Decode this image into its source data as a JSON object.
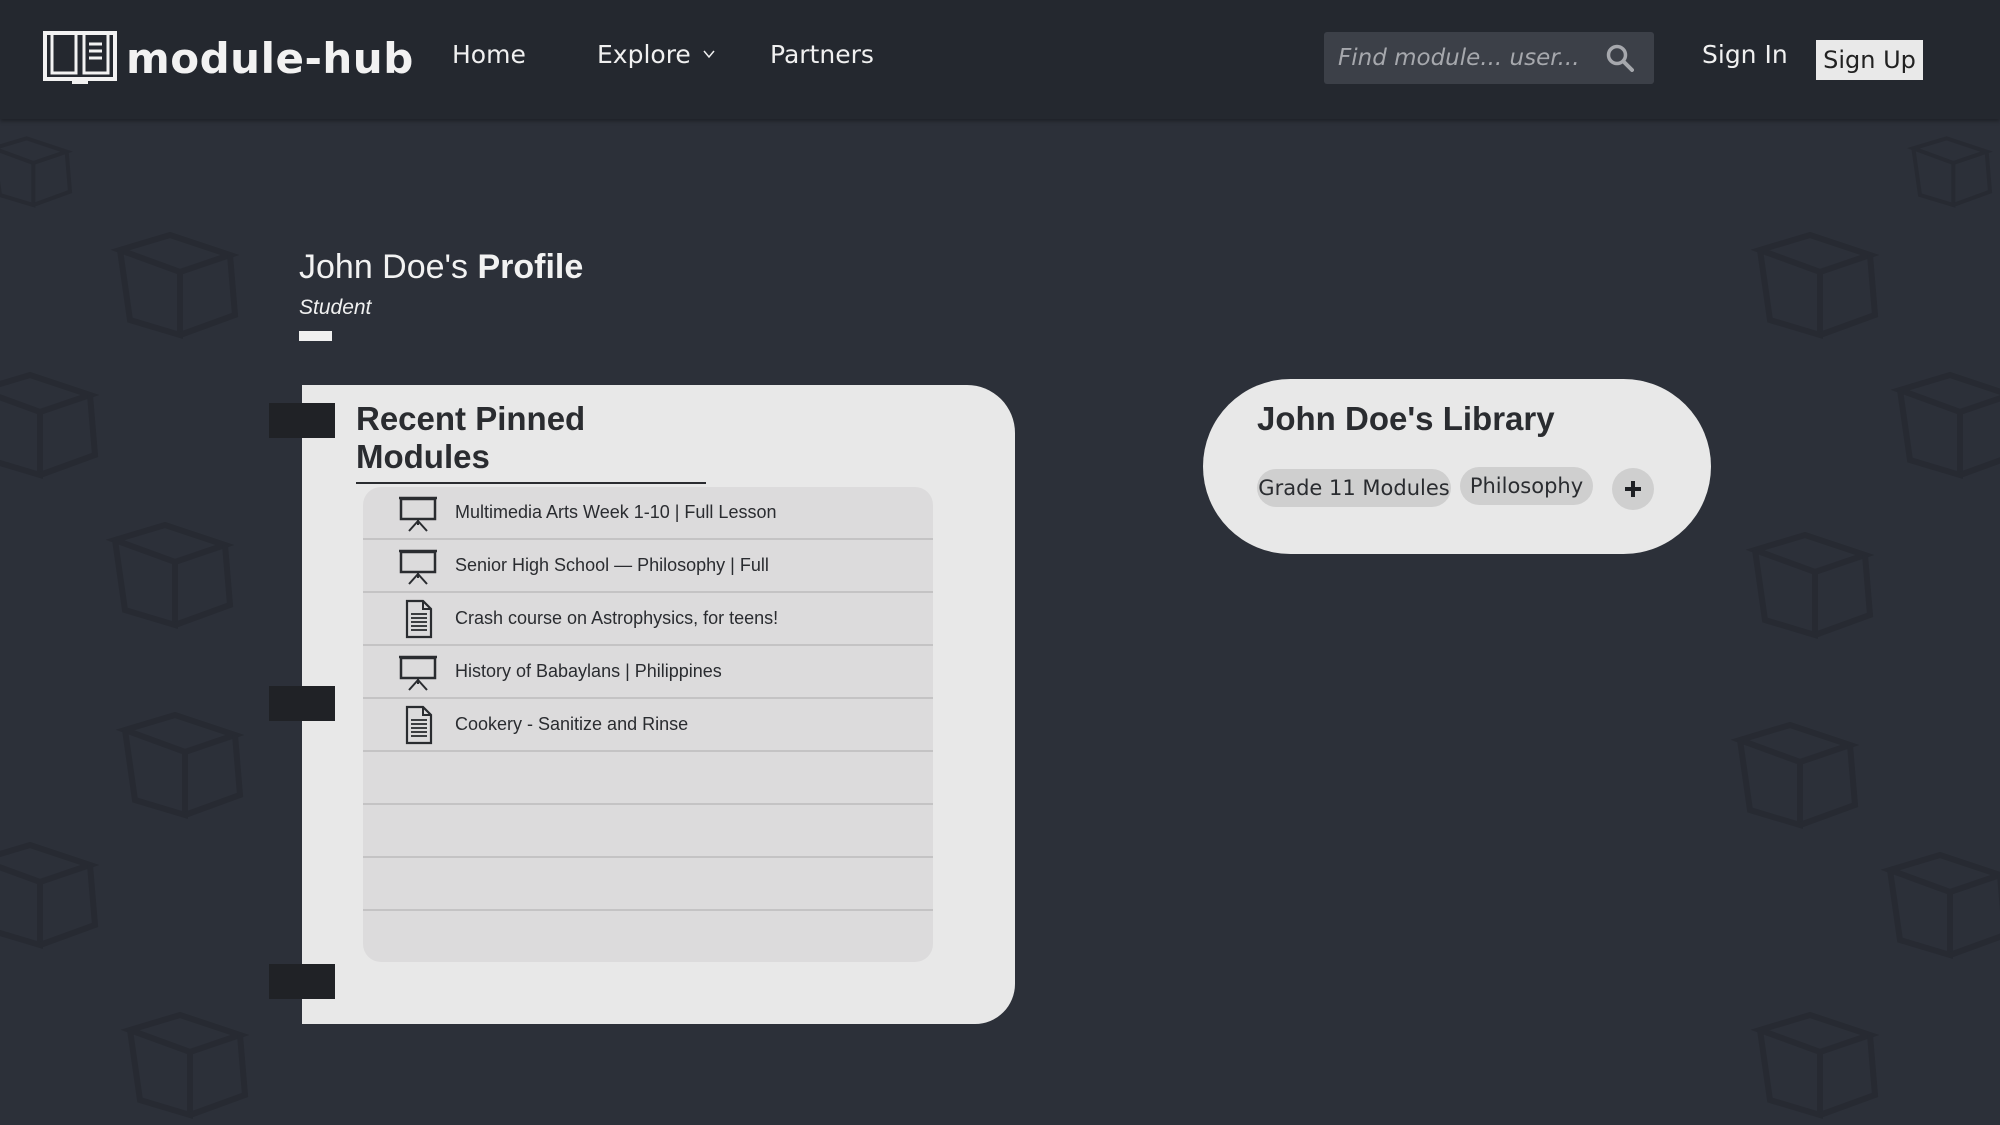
{
  "nav": {
    "brand": "module-hub",
    "links": {
      "home": "Home",
      "explore": "Explore",
      "partners": "Partners"
    },
    "search_placeholder": "Find module... user...",
    "sign_in": "Sign In",
    "sign_up": "Sign Up"
  },
  "profile": {
    "name_prefix": "John Doe's ",
    "title_suffix": "Profile",
    "role": "Student"
  },
  "pinned": {
    "title": "Recent Pinned Modules",
    "items": [
      {
        "label": "Multimedia Arts Week 1-10 | Full Lesson",
        "icon": "presentation-icon"
      },
      {
        "label": "Senior High School — Philosophy | Full",
        "icon": "presentation-icon"
      },
      {
        "label": "Crash course on Astrophysics, for teens!",
        "icon": "document-icon"
      },
      {
        "label": "History of Babaylans | Philippines",
        "icon": "presentation-icon"
      },
      {
        "label": "Cookery - Sanitize and Rinse",
        "icon": "document-icon"
      }
    ]
  },
  "library": {
    "name_prefix": "John Doe's ",
    "title_suffix": "Library",
    "tags": [
      "Grade 11 Modules",
      "Philosophy"
    ],
    "add_icon": "plus-icon"
  },
  "colors": {
    "page_bg": "#2c3039",
    "navbar_bg": "#24282f",
    "card_bg": "#e8e8e8",
    "list_bg": "#dcdbdc",
    "dark_text": "#2a2c30"
  }
}
